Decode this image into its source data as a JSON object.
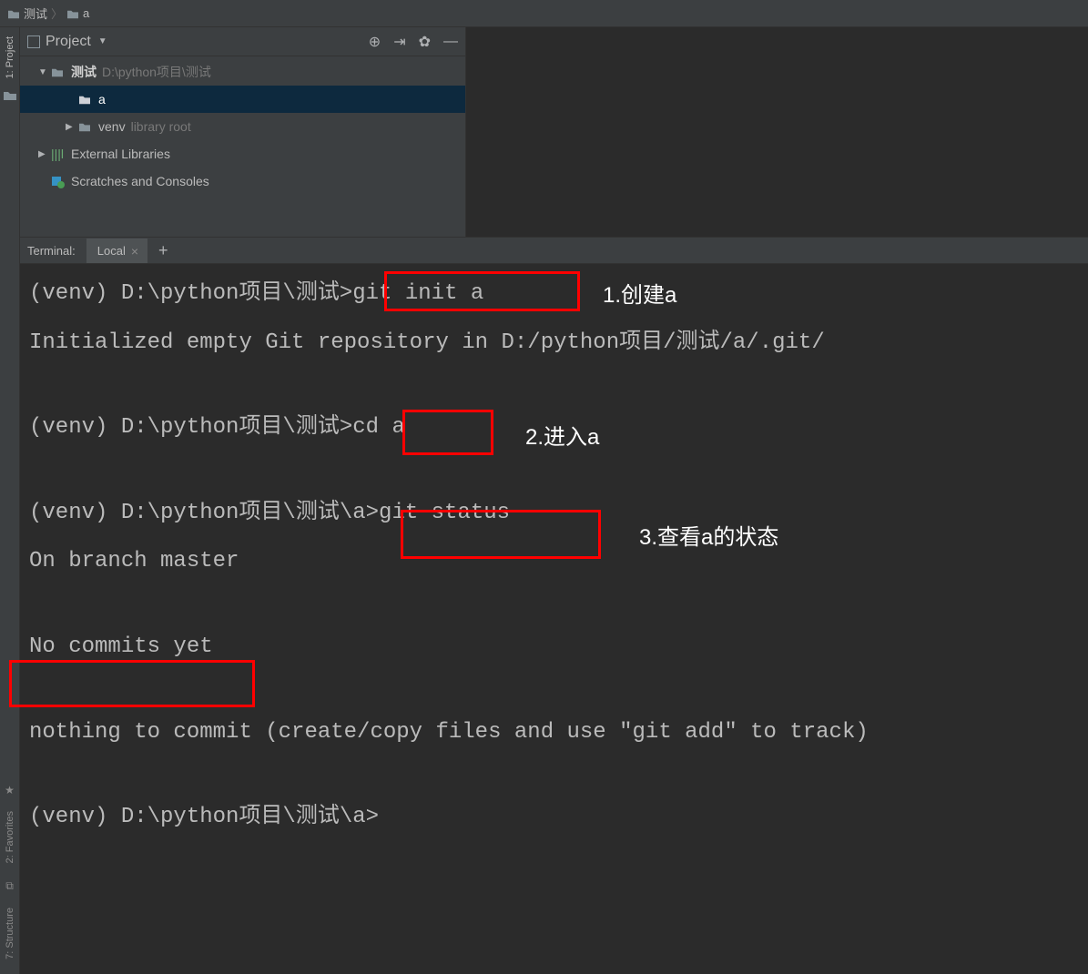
{
  "breadcrumb": {
    "root": "测试",
    "child": "a"
  },
  "projectHeader": {
    "title": "Project"
  },
  "tree": {
    "root": {
      "name": "测试",
      "path": "D:\\python项目\\测试"
    },
    "a": {
      "name": "a"
    },
    "venv": {
      "name": "venv",
      "note": "library root"
    },
    "ext": {
      "name": "External Libraries"
    },
    "scratch": {
      "name": "Scratches and Consoles"
    }
  },
  "leftStrip": {
    "project": "1: Project"
  },
  "blStrip": {
    "fav": "2: Favorites",
    "struct": "7: Structure"
  },
  "terminalTabs": {
    "label": "Terminal:",
    "local": "Local"
  },
  "terminal": {
    "l1_prompt": "(venv) D:\\python项目\\测试>",
    "l1_cmd": "git init a",
    "l2": "Initialized empty Git repository in D:/python项目/测试/a/.git/",
    "l3_prompt": "(venv) D:\\python项目\\测试>",
    "l3_cmd": "cd a",
    "l4_prompt": "(venv) D:\\python项目\\测试\\a>",
    "l4_cmd": "git status",
    "l5": "On branch master",
    "l6": "No commits yet",
    "l7": "nothing to commit (create/copy files and use \"git add\" to track)",
    "l8_prompt": "(venv) D:\\python项目\\测试\\a>"
  },
  "annotations": {
    "a1": "1.创建a",
    "a2": "2.进入a",
    "a3": "3.查看a的状态"
  }
}
